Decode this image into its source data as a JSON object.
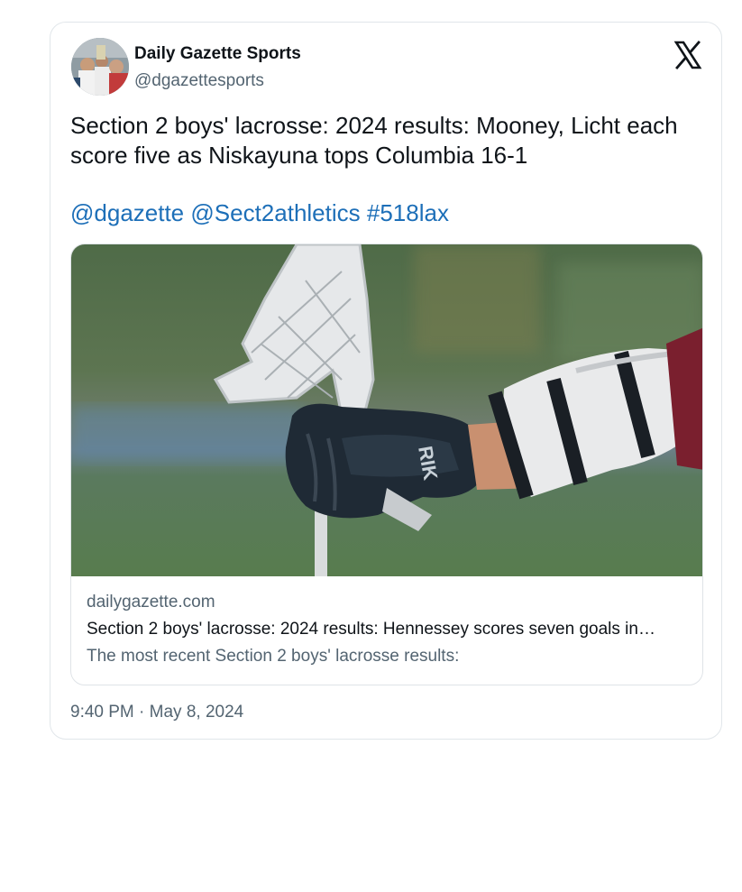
{
  "tweet": {
    "author": {
      "name": "Daily Gazette Sports",
      "handle": "@dgazettesports",
      "avatar_icon": "team-photo-avatar"
    },
    "platform_icon": "x-logo-icon",
    "text": "Section 2 boys' lacrosse: 2024 results: Mooney, Licht each score five as Niskayuna tops Columbia 16-1",
    "mentions": [
      "@dgazette",
      "@Sect2athletics",
      "#518lax"
    ],
    "link_card": {
      "image_icon": "lacrosse-stick-photo",
      "domain": "dailygazette.com",
      "title": "Section 2 boys' lacrosse: 2024 results: Hennessey scores seven goals in…",
      "description": "The most recent Section 2 boys' lacrosse results:"
    },
    "timestamp": "9:40 PM · May 8, 2024"
  },
  "colors": {
    "text_primary": "#0f1419",
    "text_secondary": "#536471",
    "link": "#1d6fb8",
    "border": "#e1e6ea"
  }
}
